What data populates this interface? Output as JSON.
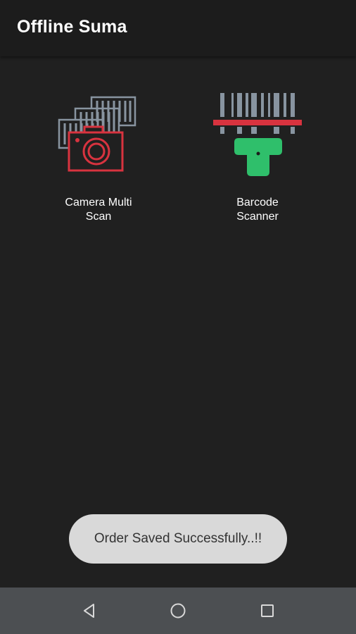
{
  "app_bar": {
    "title": "Offline Suma"
  },
  "tiles": [
    {
      "label": "Camera Multi\nScan",
      "icon": "camera-multi-scan-icon"
    },
    {
      "label": "Barcode\nScanner",
      "icon": "barcode-scanner-icon"
    }
  ],
  "toast": {
    "message": "Order Saved Successfully..!!"
  },
  "nav_bar": {
    "buttons": [
      "back-icon",
      "home-icon",
      "recents-icon"
    ]
  },
  "colors": {
    "background": "#202020",
    "app_bar": "#1c1c1c",
    "camera_red": "#d8333f",
    "scanner_green": "#2fbf6b",
    "barcode_gray": "#8894a0",
    "toast_bg": "#d9d9d9",
    "nav_bar": "#4c4f52"
  }
}
